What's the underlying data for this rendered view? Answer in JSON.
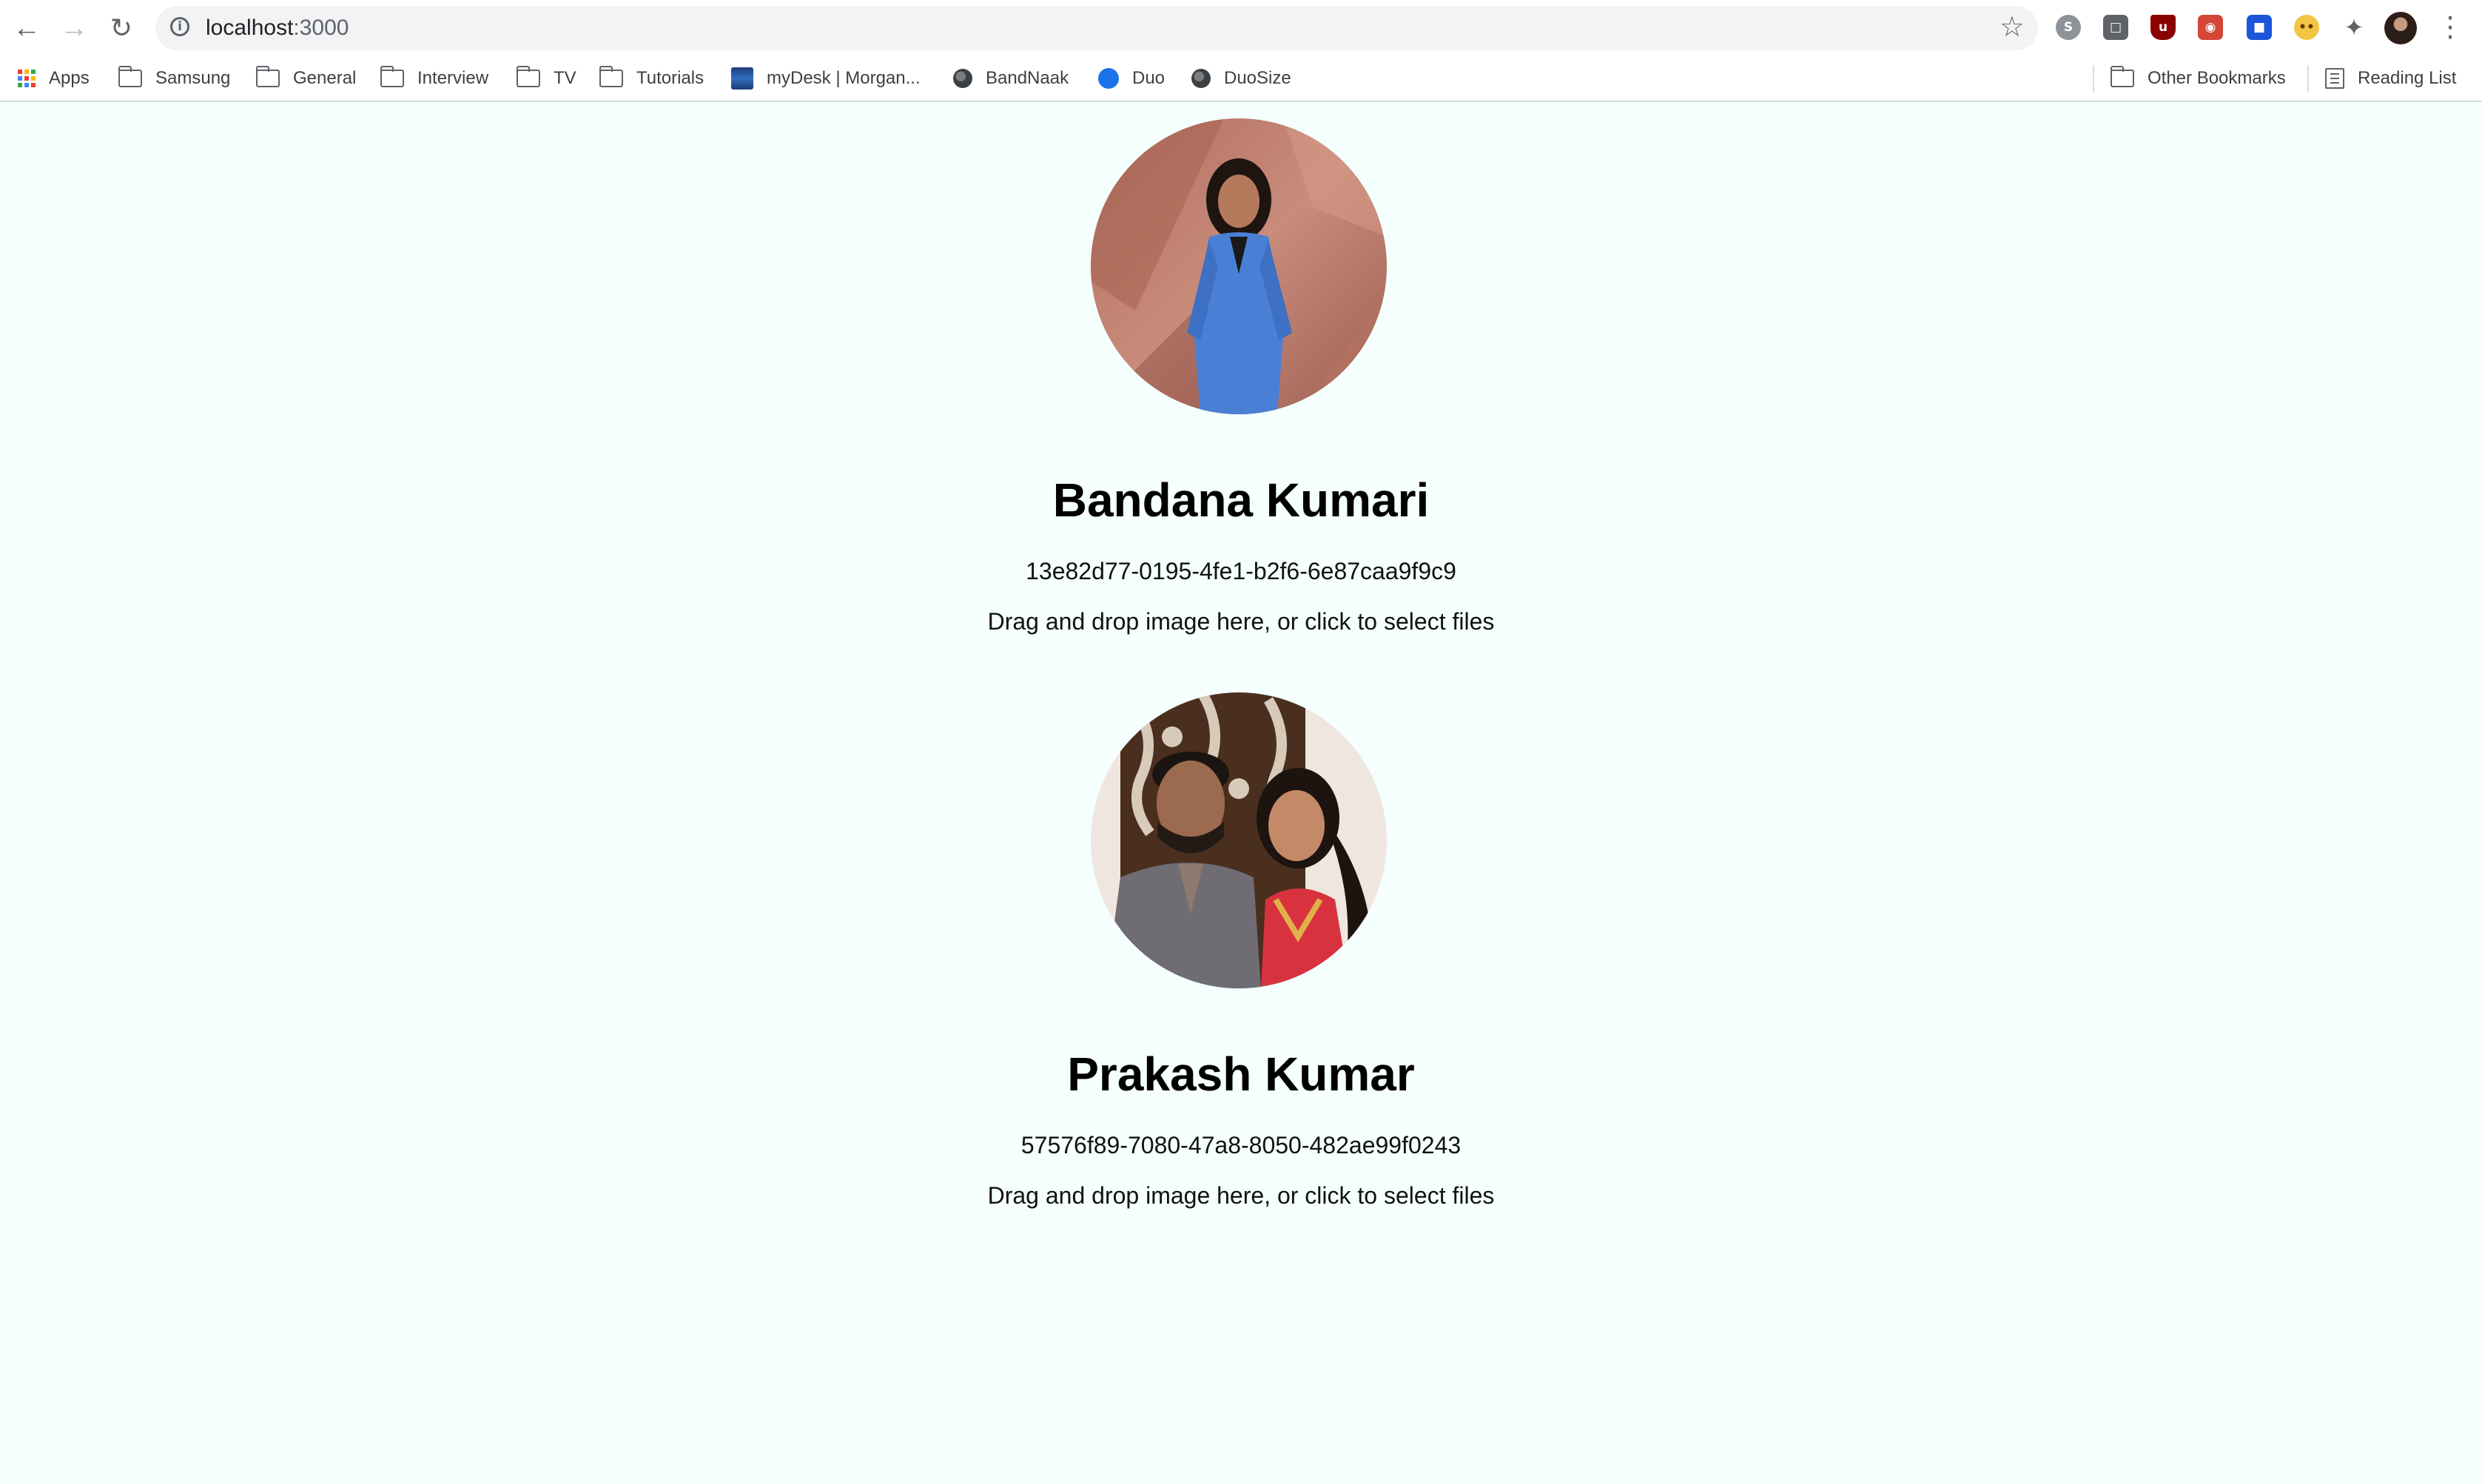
{
  "browser": {
    "url_host": "localhost",
    "url_port": ":3000",
    "nav": {
      "back_icon": "arrow-left-icon",
      "forward_icon": "arrow-right-icon",
      "reload_icon": "reload-icon"
    },
    "extensions": [
      "skype-icon",
      "extension-icon",
      "ublock-icon",
      "screenshot-extension-icon",
      "extension-blue-icon",
      "cat-extension-icon",
      "puzzle-icon"
    ]
  },
  "bookmarks": {
    "items": [
      {
        "label": "Apps",
        "icon": "apps-grid-icon"
      },
      {
        "label": "Samsung",
        "icon": "folder-icon"
      },
      {
        "label": "General",
        "icon": "folder-icon"
      },
      {
        "label": "Interview",
        "icon": "folder-icon"
      },
      {
        "label": "TV",
        "icon": "folder-icon"
      },
      {
        "label": "Tutorials",
        "icon": "folder-icon"
      },
      {
        "label": "myDesk | Morgan...",
        "icon": "mydesk-icon"
      },
      {
        "label": "BandNaak",
        "icon": "globe-icon"
      },
      {
        "label": "Duo",
        "icon": "duo-icon"
      },
      {
        "label": "DuoSize",
        "icon": "globe-icon"
      }
    ],
    "other": "Other Bookmarks",
    "reading_list": "Reading List"
  },
  "profiles": [
    {
      "name": "Bandana Kumari",
      "id": "13e82d77-0195-4fe1-b2f6-6e87caa9f9c9",
      "drop_hint": "Drag and drop image here, or click to select files"
    },
    {
      "name": "Prakash Kumar",
      "id": "57576f89-7080-47a8-8050-482ae99f0243",
      "drop_hint": "Drag and drop image here, or click to select files"
    }
  ],
  "colors": {
    "page_background": "#f4fffe",
    "chrome_background": "#ffffff",
    "omnibox_background": "#f1f3f4"
  }
}
